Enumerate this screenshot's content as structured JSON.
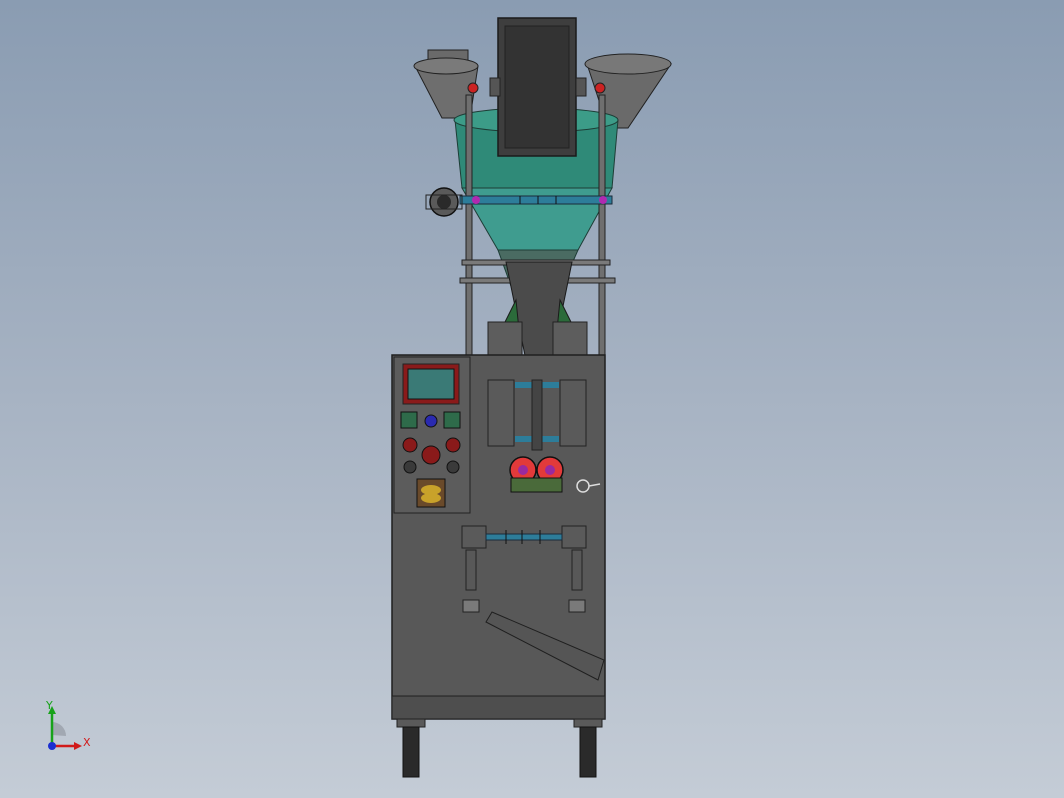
{
  "viewport": {
    "background_top": "#8a9cb2",
    "background_bottom": "#c4ccd6"
  },
  "model": {
    "name": "vertical-packaging-machine",
    "body_color": "#585858",
    "hopper_color": "#2f8a78",
    "funnel_color": "#3f9c8f",
    "wheel_color": "#e23a3a",
    "panel_screen_color": "#3a7a76",
    "panel_frame_color": "#8a1a1a"
  },
  "triad": {
    "x_label": "X",
    "y_label": "Y",
    "x_color": "#d11a1a",
    "y_color": "#17a21a",
    "z_color": "#1a2fd1"
  }
}
